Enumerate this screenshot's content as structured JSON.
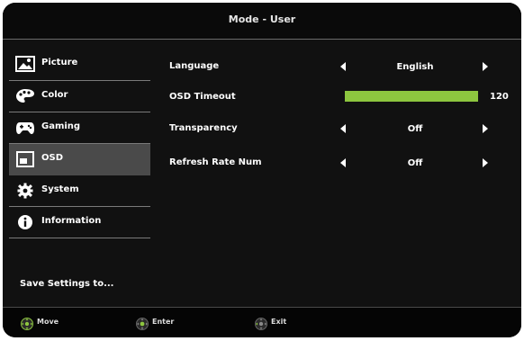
{
  "header": {
    "title": "Mode - User"
  },
  "sidebar": {
    "items": [
      {
        "label": "Picture",
        "icon": "picture-icon"
      },
      {
        "label": "Color",
        "icon": "palette-icon"
      },
      {
        "label": "Gaming",
        "icon": "gamepad-icon"
      },
      {
        "label": "OSD",
        "icon": "osd-icon",
        "active": true
      },
      {
        "label": "System",
        "icon": "gear-icon"
      },
      {
        "label": "Information",
        "icon": "info-icon"
      }
    ],
    "save_label": "Save Settings to..."
  },
  "settings": {
    "language": {
      "label": "Language",
      "value": "English"
    },
    "osd_timeout": {
      "label": "OSD Timeout",
      "value": "120",
      "level": 1.0
    },
    "transparency": {
      "label": "Transparency",
      "value": "Off"
    },
    "refresh_rate_num": {
      "label": "Refresh Rate Num",
      "value": "Off"
    }
  },
  "footer": {
    "move": "Move",
    "enter": "Enter",
    "exit": "Exit"
  },
  "colors": {
    "accent": "#8dc63f",
    "background": "#111111",
    "active_item": "#4a4a4a"
  }
}
